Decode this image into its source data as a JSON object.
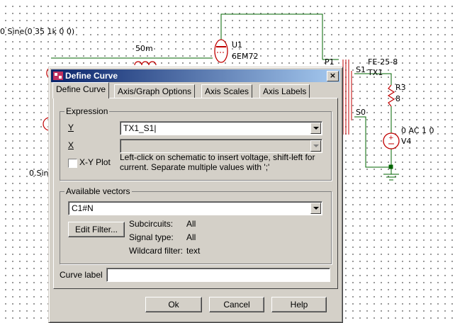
{
  "schematic": {
    "source_label": "0 Sine(0 35 1k 0 0)",
    "inductor_value": "50m",
    "tube_ref": "U1",
    "tube_model": "6EM72",
    "p1_label": "P1",
    "s1_label": "S1",
    "s0_label": "S0",
    "transformer_model": "FE-25-8",
    "transformer_ref": "TX1",
    "resistor_ref": "R3",
    "resistor_value": "8",
    "v4_value": "0 AC 1 0",
    "v4_ref": "V4",
    "left_partial_label": "0.Sin"
  },
  "dialog": {
    "title": "Define Curve",
    "close_glyph": "×",
    "tabs": [
      "Define Curve",
      "Axis/Graph Options",
      "Axis Scales",
      "Axis Labels"
    ],
    "expression": {
      "group_label": "Expression",
      "y_label": "Y",
      "y_value": "TX1_S1|",
      "x_label": "X",
      "x_value": "",
      "xy_plot_label": "X-Y Plot",
      "hint_line1": "Left-click on schematic to insert voltage, shift-left for",
      "hint_line2": "current. Separate multiple values with ';'"
    },
    "vectors": {
      "group_label": "Available vectors",
      "selected": "C1#N",
      "edit_filter_label": "Edit Filter...",
      "subcircuits_label": "Subcircuits:",
      "subcircuits_value": "All",
      "signal_type_label": "Signal type:",
      "signal_type_value": "All",
      "wildcard_label": "Wildcard filter:",
      "wildcard_value": "text"
    },
    "curve_label_label": "Curve label",
    "curve_label_value": "",
    "ok_label": "Ok",
    "cancel_label": "Cancel",
    "help_label": "Help"
  },
  "colors": {
    "wire": "#006400",
    "component": "#c00000",
    "title_gradient_start": "#0a246a",
    "title_gradient_end": "#a6caf0",
    "dialog_face": "#d4d0c8"
  }
}
